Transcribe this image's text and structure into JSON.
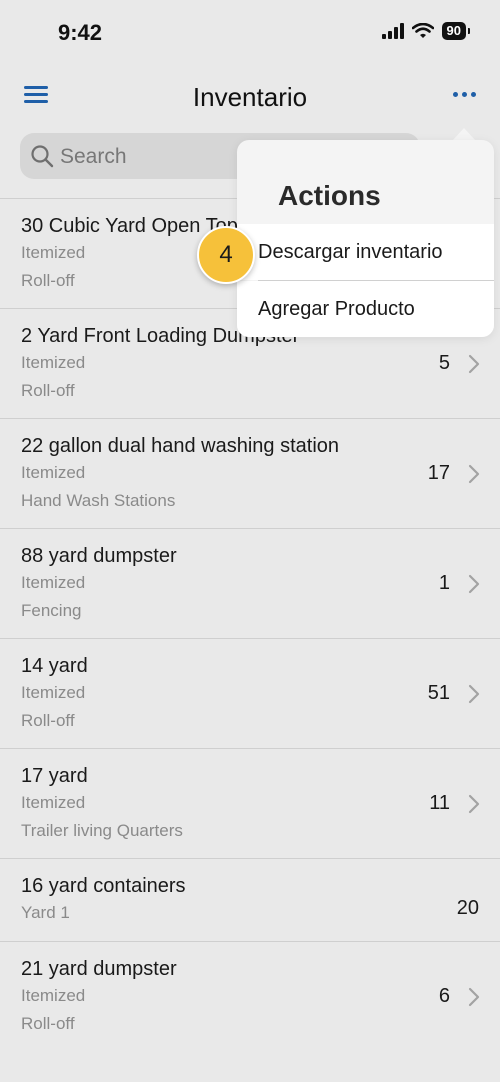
{
  "status_bar": {
    "time": "9:42",
    "battery": "90"
  },
  "nav": {
    "title": "Inventario"
  },
  "search": {
    "placeholder": "Search"
  },
  "items": [
    {
      "name": "30 Cubic Yard Open Top",
      "type": "Itemized",
      "category": "Roll-off",
      "count": ""
    },
    {
      "name": "2 Yard Front Loading Dumpster",
      "type": "Itemized",
      "category": "Roll-off",
      "count": "5"
    },
    {
      "name": "22 gallon dual hand washing station",
      "type": "Itemized",
      "category": "Hand Wash Stations",
      "count": "17"
    },
    {
      "name": "88 yard dumpster",
      "type": "Itemized",
      "category": "Fencing",
      "count": "1"
    },
    {
      "name": "14 yard",
      "type": "Itemized",
      "category": "Roll-off",
      "count": "51"
    },
    {
      "name": "17 yard",
      "type": "Itemized",
      "category": "Trailer living Quarters",
      "count": "11"
    },
    {
      "name": "16 yard containers",
      "type": "Yard 1",
      "count": "20"
    },
    {
      "name": "21 yard dumpster",
      "type": "Itemized",
      "category": "Roll-off",
      "count": "6"
    }
  ],
  "actions_menu": {
    "title": "Actions",
    "items": [
      {
        "label": "Descargar inventario"
      },
      {
        "label": "Agregar Producto"
      }
    ]
  },
  "step_badge": "4",
  "colors": {
    "accent": "#1f5fa8",
    "badge": "#f6c13a",
    "background": "#e9e9e9"
  },
  "icons": {
    "menu": "hamburger-icon",
    "more": "more-horizontal-icon",
    "search": "search-icon",
    "chevron": "chevron-right-icon"
  }
}
